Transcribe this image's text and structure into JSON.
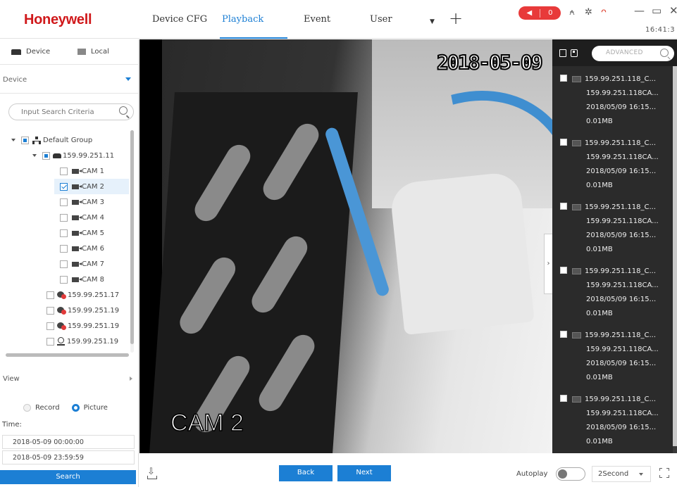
{
  "header": {
    "logo": "Honeywell",
    "tabs": [
      {
        "label": "Device CFG"
      },
      {
        "label": "Playback"
      },
      {
        "label": "Event"
      },
      {
        "label": "User"
      }
    ],
    "tab_more_icon": "chevron-down-icon",
    "add_tab_label": "+",
    "alarm_count": "0",
    "clock": "16:41:3"
  },
  "left": {
    "source_tabs": {
      "device": "Device",
      "local": "Local"
    },
    "device_select": "Device",
    "search_placeholder": "Input Search Criteria",
    "tree": {
      "group": "Default Group",
      "nvr": "159.99.251.11",
      "cams": [
        "CAM 1",
        "CAM 2",
        "CAM 3",
        "CAM 4",
        "CAM 5",
        "CAM 6",
        "CAM 7",
        "CAM 8"
      ],
      "devices": [
        "159.99.251.17",
        "159.99.251.19",
        "159.99.251.19",
        "159.99.251.19"
      ]
    },
    "view_label": "View",
    "record_label": "Record",
    "picture_label": "Picture",
    "time_label": "Time:",
    "start_time": "2018-05-09 00:00:00",
    "end_time": "2018-05-09 23:59:59",
    "search_button": "Search"
  },
  "video": {
    "osd_date": "2018-05-09",
    "osd_camera": "CAM 2"
  },
  "files": {
    "advanced_placeholder": "ADVANCED",
    "items": [
      {
        "name": "159.99.251.118_C...",
        "subname": "159.99.251.118CA...",
        "time": "2018/05/09 16:15...",
        "size": "0.01MB"
      },
      {
        "name": "159.99.251.118_C...",
        "subname": "159.99.251.118CA...",
        "time": "2018/05/09 16:15...",
        "size": "0.01MB"
      },
      {
        "name": "159.99.251.118_C...",
        "subname": "159.99.251.118CA...",
        "time": "2018/05/09 16:15...",
        "size": "0.01MB"
      },
      {
        "name": "159.99.251.118_C...",
        "subname": "159.99.251.118CA...",
        "time": "2018/05/09 16:15...",
        "size": "0.01MB"
      },
      {
        "name": "159.99.251.118_C...",
        "subname": "159.99.251.118CA...",
        "time": "2018/05/09 16:15...",
        "size": "0.01MB"
      },
      {
        "name": "159.99.251.118_C...",
        "subname": "159.99.251.118CA...",
        "time": "2018/05/09 16:15...",
        "size": "0.01MB"
      }
    ]
  },
  "bottom": {
    "back_button": "Back",
    "next_button": "Next",
    "autoplay_label": "Autoplay",
    "autoplay_on": false,
    "speed": "2Second"
  },
  "colors": {
    "accent": "#1c7fd4",
    "brand": "#d0191b",
    "alarm": "#e83a3a"
  }
}
